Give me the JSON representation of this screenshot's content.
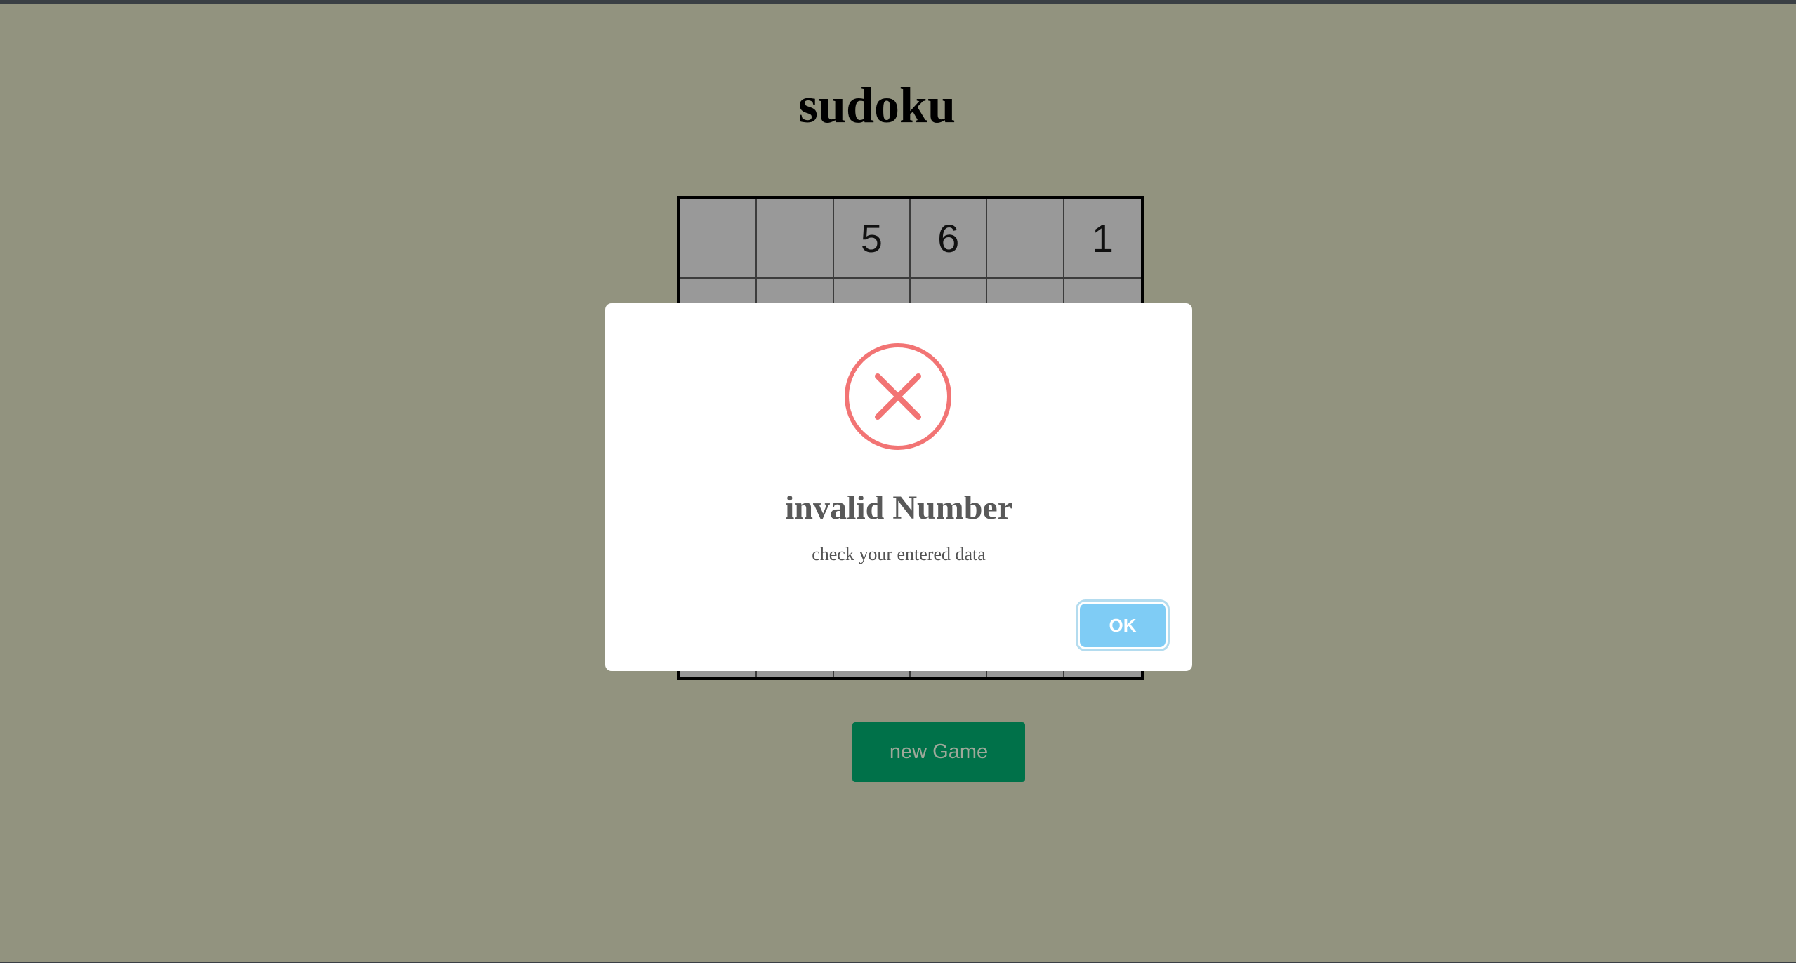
{
  "page": {
    "title": "sudoku",
    "new_game_label": "new Game"
  },
  "board": {
    "rows": [
      [
        "",
        "",
        "5",
        "6",
        "",
        "1"
      ],
      [
        "",
        "",
        "",
        "",
        "",
        ""
      ],
      [
        "",
        "",
        "",
        "",
        "",
        ""
      ],
      [
        "",
        "",
        "",
        "",
        "",
        ""
      ],
      [
        "",
        "",
        "",
        "",
        "",
        ""
      ],
      [
        "",
        "",
        "",
        "",
        "",
        ""
      ]
    ]
  },
  "dialog": {
    "icon": "error-x-circle-icon",
    "title": "invalid Number",
    "text": "check your entered data",
    "ok_label": "OK"
  },
  "colors": {
    "background": "#92937f",
    "cell": "#999999",
    "new_game_button": "#007149",
    "error_icon": "#f27474",
    "ok_button": "#7fccf5"
  }
}
